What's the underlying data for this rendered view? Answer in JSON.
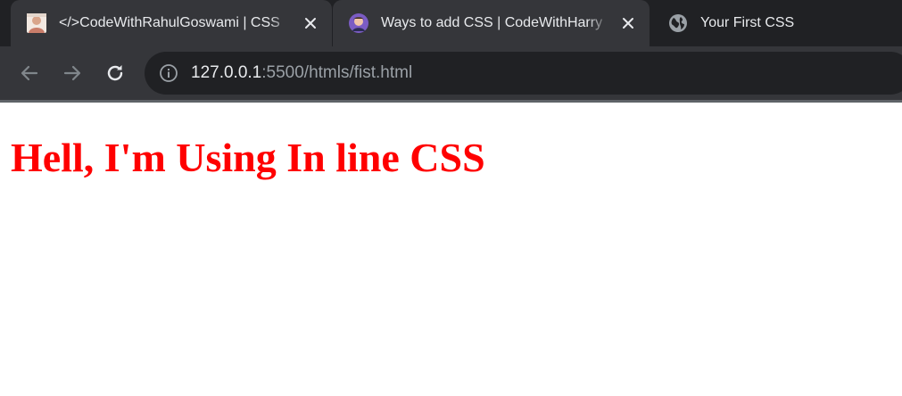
{
  "browser": {
    "tabs": [
      {
        "title": "</>CodeWithRahulGoswami | CSS",
        "favicon": "user-photo-icon",
        "active": false
      },
      {
        "title": "Ways to add CSS | CodeWithHarry",
        "favicon": "avatar-icon",
        "active": false
      },
      {
        "title": "Your First CSS",
        "favicon": "globe-icon",
        "active": true
      }
    ],
    "address": {
      "host": "127.0.0.1",
      "rest": ":5500/htmls/fist.html"
    }
  },
  "page": {
    "heading": "Hell, I'm Using In line CSS",
    "heading_color": "#ff0000"
  }
}
